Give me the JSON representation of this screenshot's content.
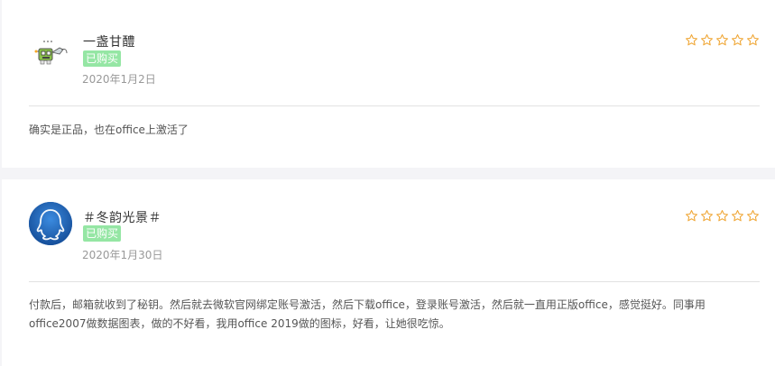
{
  "reviews": [
    {
      "username": "一盏甘醴",
      "badge": "已购买",
      "date": "2020年1月2日",
      "comment": "确实是正品，也在office上激活了",
      "star_color": "#f0a93b",
      "avatar": "robot-sticker-avatar"
    },
    {
      "username": "＃冬韵光景＃",
      "badge": "已购买",
      "date": "2020年1月30日",
      "comment": "付款后，邮箱就收到了秘钥。然后就去微软官网绑定账号激活，然后下载office，登录账号激活，然后就一直用正版office，感觉挺好。同事用office2007做数据图表，做的不好看，我用office 2019做的图标，好看，让她很吃惊。",
      "star_color": "#f0a93b",
      "avatar": "qq-penguin-avatar"
    }
  ],
  "colors": {
    "badge_bg": "#95e6a4",
    "star": "#f0a93b",
    "page_bg": "#f4f4f7"
  }
}
